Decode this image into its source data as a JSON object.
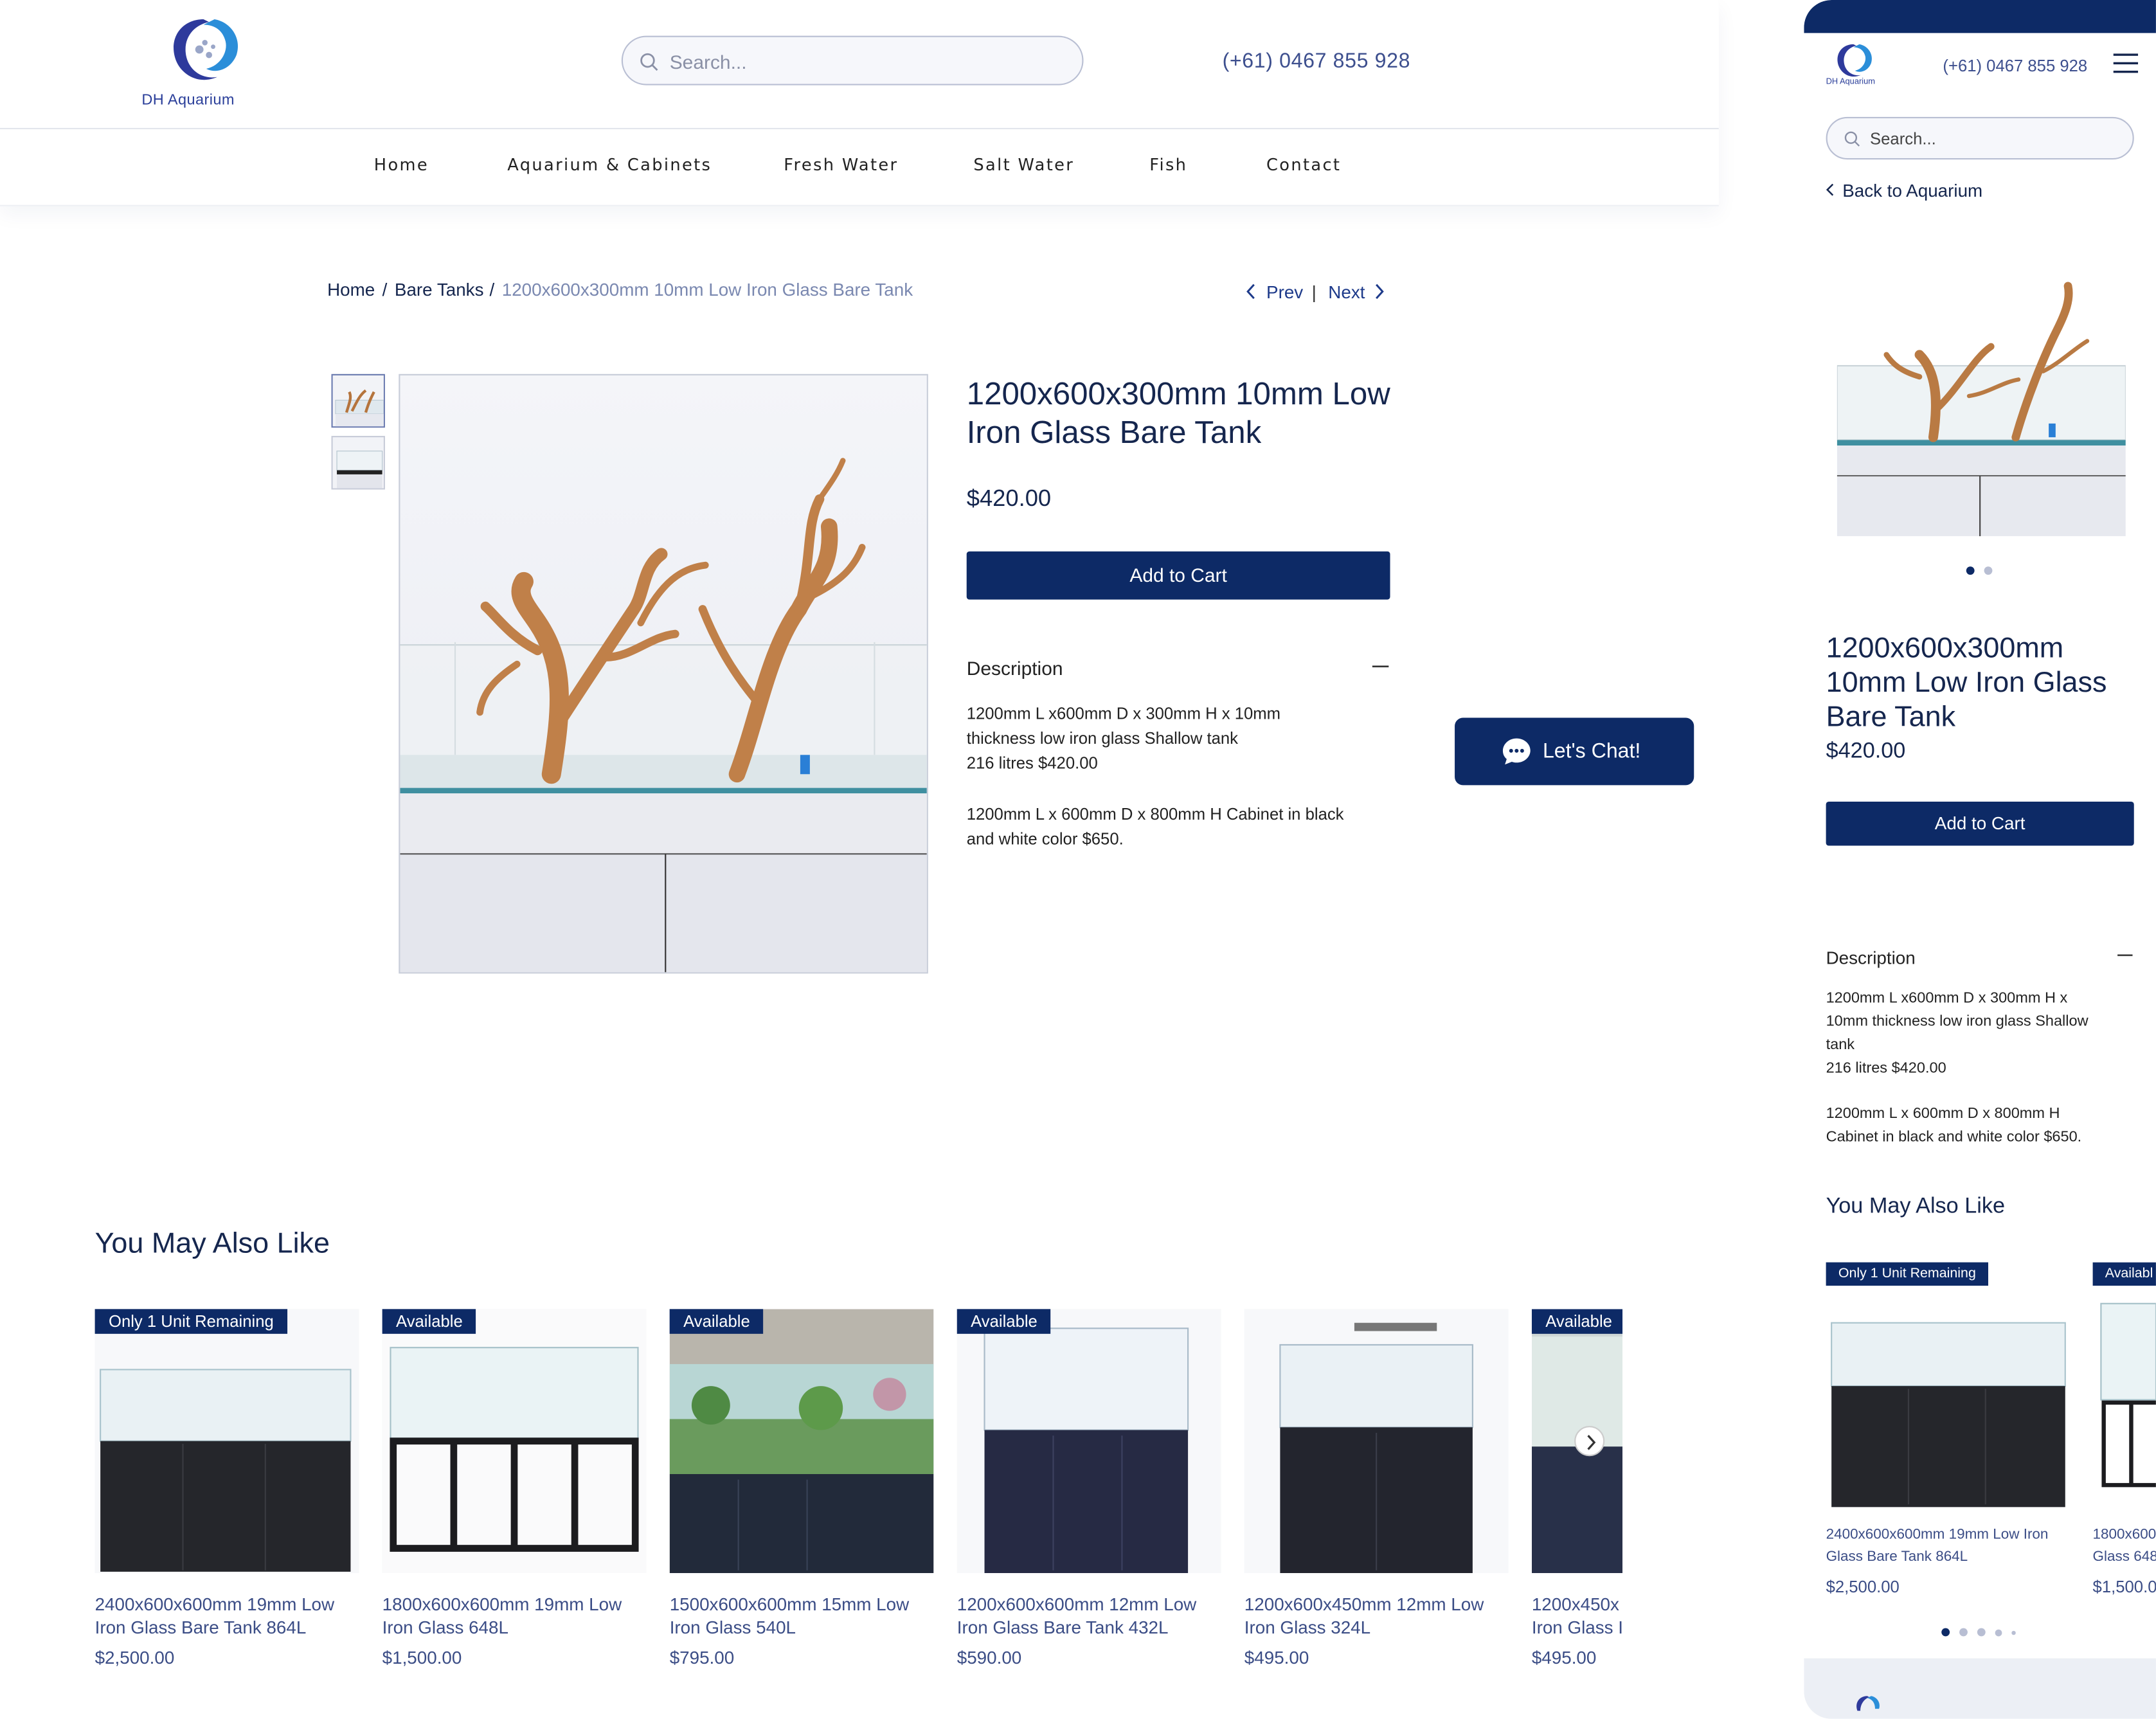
{
  "brand": {
    "name": "DH Aquarium",
    "accent": "#0d2a66",
    "light_accent": "#2b8ed9"
  },
  "header": {
    "search_placeholder": "Search...",
    "phone": "(+61) 0467 855 928",
    "nav": [
      "Home",
      "Aquarium & Cabinets",
      "Fresh Water",
      "Salt Water",
      "Fish",
      "Contact"
    ]
  },
  "breadcrumb": {
    "home": "Home",
    "sep": "/",
    "category": "Bare Tanks",
    "current": "1200x600x300mm 10mm Low Iron Glass Bare Tank"
  },
  "pager": {
    "prev": "Prev",
    "divider": "|",
    "next": "Next"
  },
  "product": {
    "title": "1200x600x300mm 10mm Low Iron Glass Bare Tank",
    "price": "$420.00",
    "add_to_cart": "Add to Cart",
    "description_heading": "Description",
    "description_lines": [
      "1200mm L x600mm D x 300mm H x 10mm",
      "thickness low iron glass Shallow tank",
      "216 litres   $420.00",
      "1200mm L x 600mm D x 800mm H Cabinet in black",
      "and white color $650."
    ]
  },
  "chat": {
    "label": "Let's Chat!"
  },
  "related": {
    "heading": "You May Also Like",
    "items": [
      {
        "badge": "Only 1 Unit Remaining",
        "name": "2400x600x600mm 19mm Low Iron Glass Bare Tank 864L",
        "price": "$2,500.00"
      },
      {
        "badge": "Available",
        "name": "1800x600x600mm 19mm Low Iron Glass 648L",
        "price": "$1,500.00"
      },
      {
        "badge": "Available",
        "name": "1500x600x600mm 15mm Low Iron Glass 540L",
        "price": "$795.00"
      },
      {
        "badge": "Available",
        "name": "1200x600x600mm 12mm Low Iron Glass Bare Tank 432L",
        "price": "$590.00"
      },
      {
        "badge": "",
        "name": "1200x600x450mm 12mm Low Iron Glass 324L",
        "price": "$495.00"
      },
      {
        "badge": "Available",
        "name": "1200x450x",
        "name2": "Iron Glass I",
        "price": "$495.00"
      }
    ]
  },
  "mobile": {
    "phone": "(+61) 0467 855 928",
    "search_placeholder": "Search...",
    "back_link": "Back to Aquarium",
    "title_lines": [
      "1200x600x300mm",
      "10mm Low Iron Glass",
      "Bare Tank"
    ],
    "price": "$420.00",
    "add_to_cart": "Add to Cart",
    "description_heading": "Description",
    "description_lines": [
      "1200mm L x600mm D x 300mm H x",
      "10mm thickness low iron glass Shallow",
      "tank",
      "216 litres   $420.00",
      "1200mm L x 600mm D x 800mm H",
      "Cabinet in black and white color $650."
    ],
    "related_heading": "You May Also Like",
    "related": [
      {
        "badge": "Only 1 Unit Remaining",
        "name1": "2400x600x600mm 19mm Low Iron",
        "name2": "Glass Bare Tank 864L",
        "price": "$2,500.00"
      },
      {
        "badge": "Availabl",
        "name1": "1800x600",
        "name2": "Glass 648",
        "price": "$1,500.0"
      }
    ]
  }
}
